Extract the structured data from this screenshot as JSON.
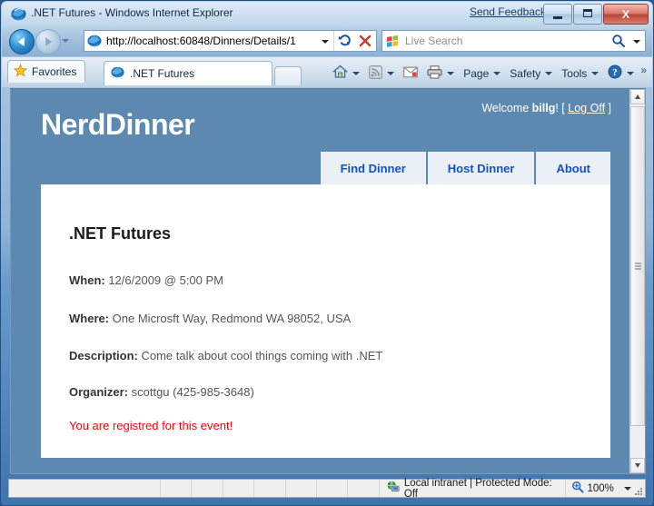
{
  "window": {
    "title": ".NET Futures - Windows Internet Explorer",
    "send_feedback": "Send Feedback",
    "minimize_label": "Minimize",
    "maximize_label": "Maximize",
    "close_label": "Close",
    "icon": "internet-explorer-icon"
  },
  "nav": {
    "back_label": "Back",
    "forward_label": "Forward",
    "history_label": "Recent Pages",
    "address": {
      "value": "http://localhost:60848/Dinners/Details/1",
      "icon": "page-icon",
      "dropdown_label": "Address dropdown",
      "refresh_label": "Refresh",
      "stop_label": "Stop"
    },
    "search": {
      "placeholder": "Live Search",
      "icon": "windows-logo-icon",
      "go_label": "Search",
      "dropdown_label": "Search provider"
    }
  },
  "tabbar": {
    "favorites_label": "Favorites",
    "favorites_icon": "star-icon",
    "tabs": [
      {
        "label": ".NET Futures",
        "icon": "internet-explorer-icon"
      }
    ],
    "new_tab_label": "New Tab",
    "commands": [
      {
        "name": "home",
        "label": "",
        "icon": "home-icon",
        "has_caret": true
      },
      {
        "name": "feeds",
        "label": "",
        "icon": "rss-icon",
        "has_caret": true
      },
      {
        "name": "read-mail",
        "label": "",
        "icon": "mail-icon",
        "has_caret": false
      },
      {
        "name": "print",
        "label": "",
        "icon": "printer-icon",
        "has_caret": true
      },
      {
        "name": "page",
        "label": "Page",
        "icon": "",
        "has_caret": true
      },
      {
        "name": "safety",
        "label": "Safety",
        "icon": "",
        "has_caret": true
      },
      {
        "name": "tools",
        "label": "Tools",
        "icon": "",
        "has_caret": true
      },
      {
        "name": "help",
        "label": "",
        "icon": "help-icon",
        "has_caret": true
      }
    ],
    "overflow_label": "»"
  },
  "page": {
    "brand": "NerdDinner",
    "login": {
      "welcome_prefix": "Welcome ",
      "username": "billg",
      "after_username": "! [ ",
      "logoff_label": "Log Off",
      "after_link": " ]"
    },
    "menu": [
      {
        "label": "Find Dinner"
      },
      {
        "label": "Host Dinner"
      },
      {
        "label": "About"
      }
    ],
    "dinner": {
      "title": ".NET Futures",
      "when_label": "When:",
      "when_value": " 12/6/2009 @ 5:00 PM",
      "where_label": "Where:",
      "where_value": " One Microsft Way, Redmond WA 98052, USA",
      "description_label": "Description:",
      "description_value": " Come talk about cool things coming with .NET",
      "organizer_label": "Organizer:",
      "organizer_value": " scottgu (425-985-3648)",
      "registered_message": "You are registred for this event!"
    },
    "colors": {
      "header_blue": "#5d89b0",
      "menu_link_blue": "#1250d2",
      "menu_bg": "#eaf0f6",
      "registered_red": "#ff0000"
    }
  },
  "scrollbar": {
    "up_label": "Scroll up",
    "down_label": "Scroll down",
    "thumb_label": "Scroll thumb"
  },
  "statusbar": {
    "zone_icon": "globe-monitor-icon",
    "zone_text": "Local intranet | Protected Mode: Off",
    "zoom_icon": "zoom-icon",
    "zoom_level": "100%"
  }
}
